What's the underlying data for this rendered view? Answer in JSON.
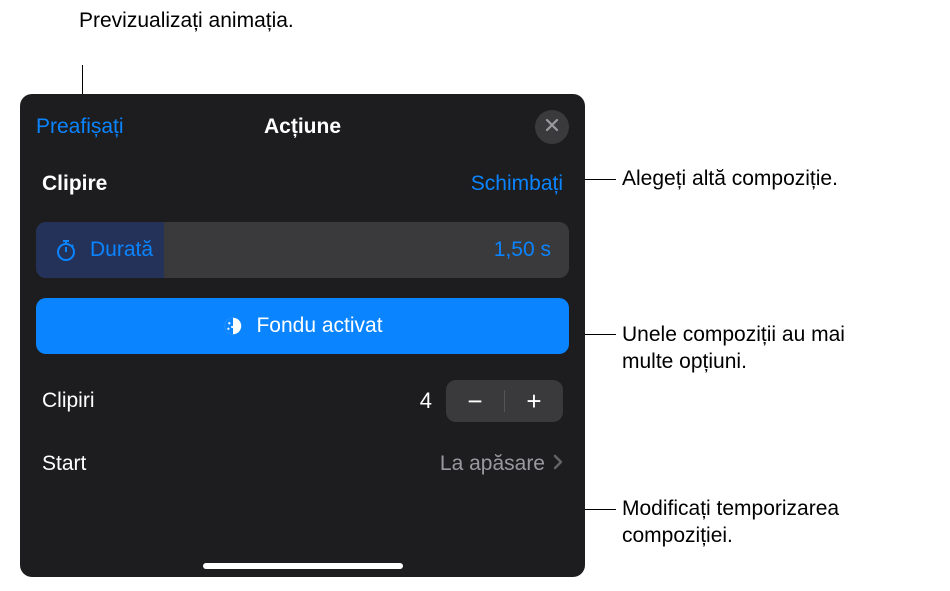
{
  "callouts": {
    "preview": "Previzualizați animația.",
    "choose": "Alegeți altă compoziție.",
    "options": "Unele compoziții au mai multe opțiuni.",
    "timing": "Modificați temporizarea compoziției."
  },
  "panel": {
    "preview_link": "Preafișați",
    "title": "Acțiune",
    "section_name": "Clipire",
    "change_link": "Schimbați",
    "duration": {
      "label": "Durată",
      "value": "1,50 s"
    },
    "toggle": {
      "label": "Fondu activat"
    },
    "stepper": {
      "label": "Clipiri",
      "value": "4"
    },
    "start": {
      "label": "Start",
      "value": "La apăsare"
    }
  }
}
